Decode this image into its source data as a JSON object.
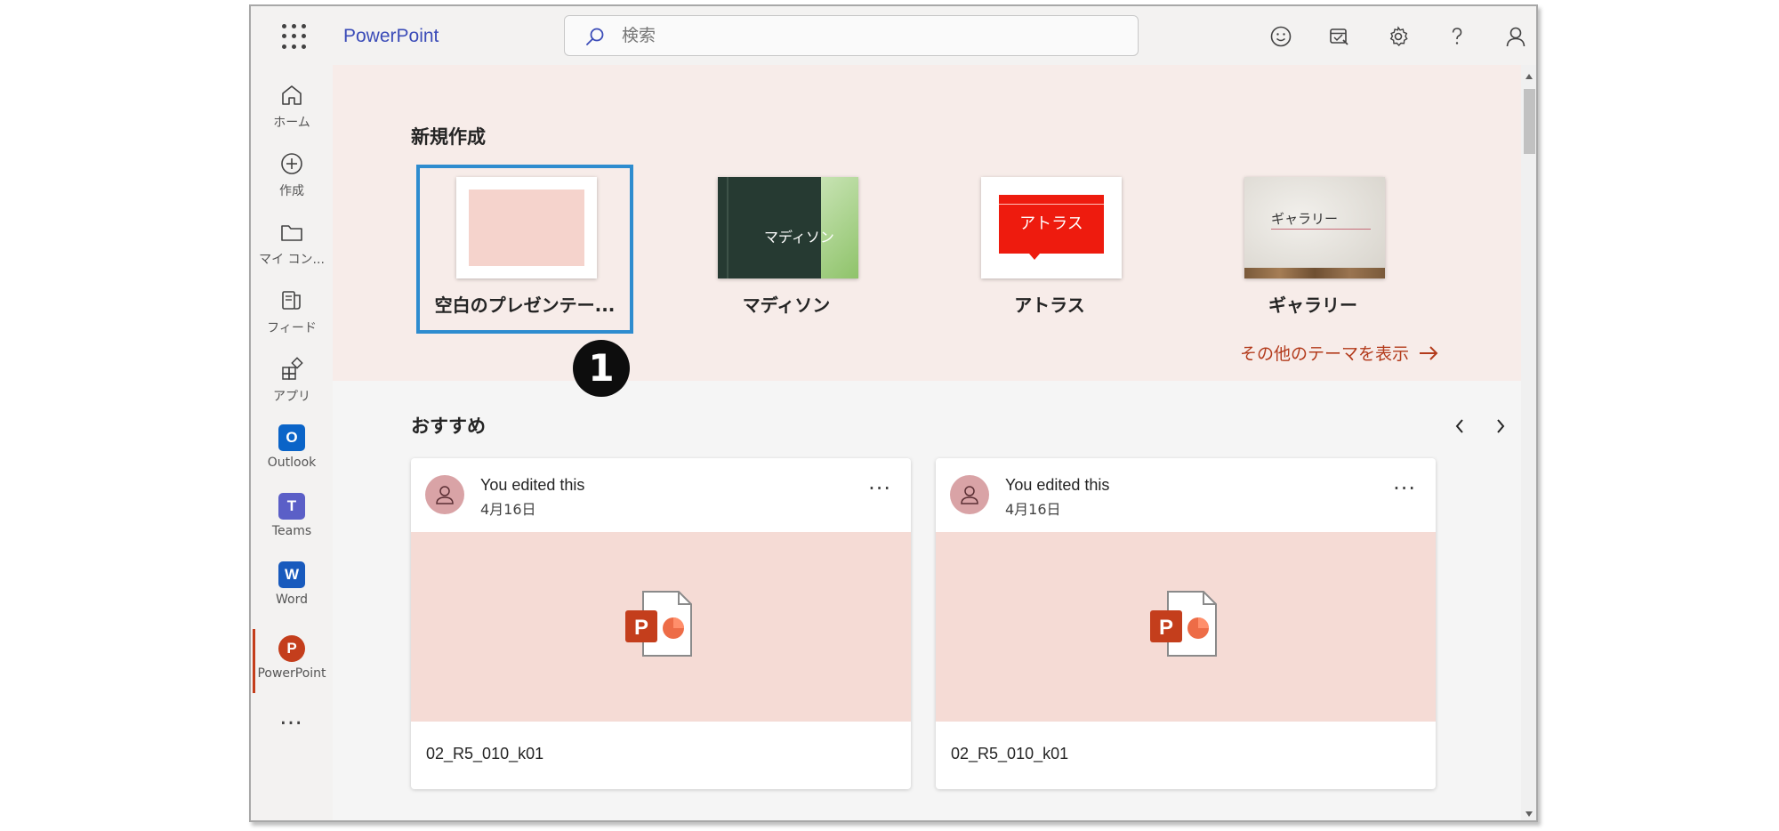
{
  "app": {
    "name": "PowerPoint"
  },
  "search": {
    "placeholder": "検索"
  },
  "header_icons": [
    "smiley-icon",
    "task-icon",
    "gear-icon",
    "help-icon",
    "account-icon"
  ],
  "rail": {
    "items": [
      {
        "label": "ホーム",
        "icon": "home-icon"
      },
      {
        "label": "作成",
        "icon": "create-icon"
      },
      {
        "label": "マイ コン...",
        "icon": "folder-icon"
      },
      {
        "label": "フィード",
        "icon": "feed-icon"
      },
      {
        "label": "アプリ",
        "icon": "apps-icon"
      },
      {
        "label": "Outlook",
        "icon": "outlook-icon"
      },
      {
        "label": "Teams",
        "icon": "teams-icon"
      },
      {
        "label": "Word",
        "icon": "word-icon"
      },
      {
        "label": "PowerPoint",
        "icon": "powerpoint-icon",
        "active": true
      }
    ],
    "more": "…"
  },
  "new_section": {
    "title": "新規作成",
    "templates": [
      {
        "name": "空白のプレゼンテー...",
        "selected": true
      },
      {
        "name": "マディソン",
        "thumb_text": "マディソン"
      },
      {
        "name": "アトラス",
        "thumb_text": "アトラス"
      },
      {
        "name": "ギャラリー",
        "thumb_text": "ギャラリー"
      }
    ],
    "more_themes": "その他のテーマを表示",
    "badge": "1"
  },
  "recommended": {
    "title": "おすすめ",
    "cards": [
      {
        "who": "You edited this",
        "when": "4月16日",
        "filename": "02_R5_010_k01"
      },
      {
        "who": "You edited this",
        "when": "4月16日",
        "filename": "02_R5_010_k01"
      }
    ]
  },
  "colors": {
    "accent": "#3b4cb8",
    "brand": "#c43e1c",
    "selection": "#2e8ccf",
    "new_bg": "#f7ece9",
    "preview_bg": "#f5dbd5"
  }
}
